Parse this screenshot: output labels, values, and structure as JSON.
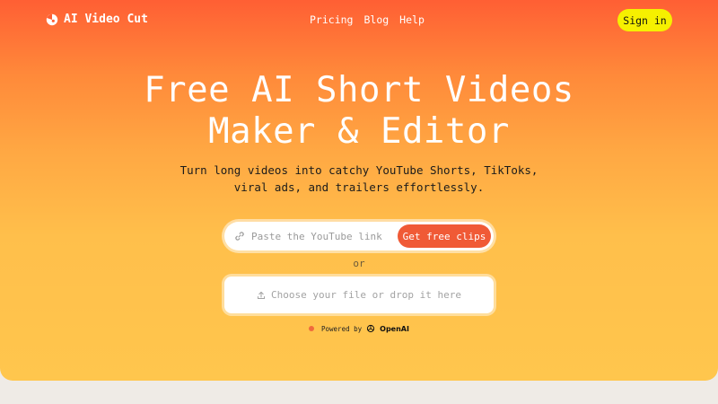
{
  "brand": {
    "name": "AI Video Cut",
    "icon": "video-cut-logo-icon"
  },
  "nav": [
    {
      "label": "Pricing"
    },
    {
      "label": "Blog"
    },
    {
      "label": "Help"
    }
  ],
  "header": {
    "signin_label": "Sign in"
  },
  "hero": {
    "title_line1": "Free AI Short Videos",
    "title_line2": "Maker & Editor",
    "subtitle_line1": "Turn long videos into catchy YouTube Shorts, TikToks,",
    "subtitle_line2": "viral ads, and trailers effortlessly."
  },
  "link_form": {
    "placeholder": "Paste the YouTube link",
    "button_label": "Get free clips",
    "icon": "link-icon"
  },
  "divider": {
    "label": "or"
  },
  "upload": {
    "label": "Choose your file or drop it here",
    "icon": "upload-icon"
  },
  "powered_by": {
    "prefix": "Powered by",
    "provider": "OpenAI"
  },
  "colors": {
    "hero_top": "#ff5f34",
    "hero_bottom": "#ffc64d",
    "cta": "#f05a36",
    "signin": "#f6f000",
    "page_bg": "#efebe6"
  }
}
